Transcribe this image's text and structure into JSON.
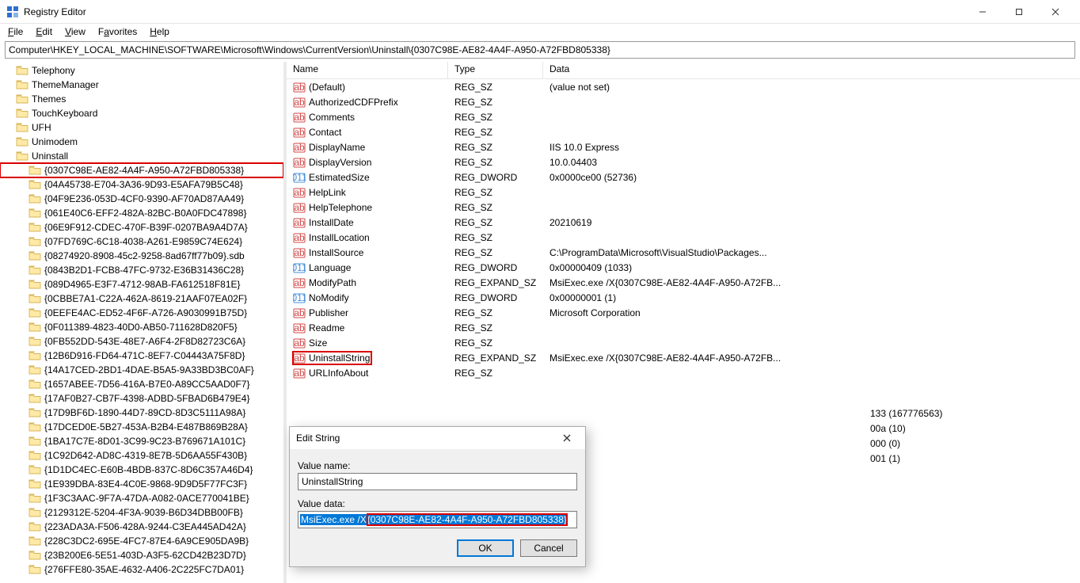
{
  "window": {
    "title": "Registry Editor"
  },
  "menu": {
    "file": "File",
    "edit": "Edit",
    "view": "View",
    "favorites": "Favorites",
    "help": "Help"
  },
  "address": "Computer\\HKEY_LOCAL_MACHINE\\SOFTWARE\\Microsoft\\Windows\\CurrentVersion\\Uninstall\\{0307C98E-AE82-4A4F-A950-A72FBD805338}",
  "tree": {
    "itemsTop": [
      "Telephony",
      "ThemeManager",
      "Themes",
      "TouchKeyboard",
      "UFH",
      "Unimodem",
      "Uninstall"
    ],
    "selected": "{0307C98E-AE82-4A4F-A950-A72FBD805338}",
    "childItems": [
      "{04A45738-E704-3A36-9D93-E5AFA79B5C48}",
      "{04F9E236-053D-4CF0-9390-AF70AD87AA49}",
      "{061E40C6-EFF2-482A-82BC-B0A0FDC47898}",
      "{06E9F912-CDEC-470F-B39F-0207BA9A4D7A}",
      "{07FD769C-6C18-4038-A261-E9859C74E624}",
      "{08274920-8908-45c2-9258-8ad67ff77b09}.sdb",
      "{0843B2D1-FCB8-47FC-9732-E36B31436C28}",
      "{089D4965-E3F7-4712-98AB-FA612518F81E}",
      "{0CBBE7A1-C22A-462A-8619-21AAF07EA02F}",
      "{0EEFE4AC-ED52-4F6F-A726-A9030991B75D}",
      "{0F011389-4823-40D0-AB50-711628D820F5}",
      "{0FB552DD-543E-48E7-A6F4-2F8D82723C6A}",
      "{12B6D916-FD64-471C-8EF7-C04443A75F8D}",
      "{14A17CED-2BD1-4DAE-B5A5-9A33BD3BC0AF}",
      "{1657ABEE-7D56-416A-B7E0-A89CC5AAD0F7}",
      "{17AF0B27-CB7F-4398-ADBD-5FBAD6B479E4}",
      "{17D9BF6D-1890-44D7-89CD-8D3C5111A98A}",
      "{17DCED0E-5B27-453A-B2B4-E487B869B28A}",
      "{1BA17C7E-8D01-3C99-9C23-B769671A101C}",
      "{1C92D642-AD8C-4319-8E7B-5D6AA55F430B}",
      "{1D1DC4EC-E60B-4BDB-837C-8D6C357A46D4}",
      "{1E939DBA-83E4-4C0E-9868-9D9D5F77FC3F}",
      "{1F3C3AAC-9F7A-47DA-A082-0ACE770041BE}",
      "{2129312E-5204-4F3A-9039-B6D34DBB00FB}",
      "{223ADA3A-F506-428A-9244-C3EA445AD42A}",
      "{228C3DC2-695E-4FC7-87E4-6A9CE905DA9B}",
      "{23B200E6-5E51-403D-A3F5-62CD42B23D7D}",
      "{276FFE80-35AE-4632-A406-2C225FC7DA01}"
    ]
  },
  "columns": {
    "name": "Name",
    "type": "Type",
    "data": "Data"
  },
  "values": [
    {
      "name": "(Default)",
      "icon": "sz",
      "type": "REG_SZ",
      "data": "(value not set)"
    },
    {
      "name": "AuthorizedCDFPrefix",
      "icon": "sz",
      "type": "REG_SZ",
      "data": ""
    },
    {
      "name": "Comments",
      "icon": "sz",
      "type": "REG_SZ",
      "data": ""
    },
    {
      "name": "Contact",
      "icon": "sz",
      "type": "REG_SZ",
      "data": ""
    },
    {
      "name": "DisplayName",
      "icon": "sz",
      "type": "REG_SZ",
      "data": "IIS 10.0 Express"
    },
    {
      "name": "DisplayVersion",
      "icon": "sz",
      "type": "REG_SZ",
      "data": "10.0.04403"
    },
    {
      "name": "EstimatedSize",
      "icon": "dw",
      "type": "REG_DWORD",
      "data": "0x0000ce00 (52736)"
    },
    {
      "name": "HelpLink",
      "icon": "sz",
      "type": "REG_SZ",
      "data": ""
    },
    {
      "name": "HelpTelephone",
      "icon": "sz",
      "type": "REG_SZ",
      "data": ""
    },
    {
      "name": "InstallDate",
      "icon": "sz",
      "type": "REG_SZ",
      "data": "20210619"
    },
    {
      "name": "InstallLocation",
      "icon": "sz",
      "type": "REG_SZ",
      "data": ""
    },
    {
      "name": "InstallSource",
      "icon": "sz",
      "type": "REG_SZ",
      "data": "C:\\ProgramData\\Microsoft\\VisualStudio\\Packages..."
    },
    {
      "name": "Language",
      "icon": "dw",
      "type": "REG_DWORD",
      "data": "0x00000409 (1033)"
    },
    {
      "name": "ModifyPath",
      "icon": "sz",
      "type": "REG_EXPAND_SZ",
      "data": "MsiExec.exe /X{0307C98E-AE82-4A4F-A950-A72FB..."
    },
    {
      "name": "NoModify",
      "icon": "dw",
      "type": "REG_DWORD",
      "data": "0x00000001 (1)"
    },
    {
      "name": "Publisher",
      "icon": "sz",
      "type": "REG_SZ",
      "data": "Microsoft Corporation"
    },
    {
      "name": "Readme",
      "icon": "sz",
      "type": "REG_SZ",
      "data": ""
    },
    {
      "name": "Size",
      "icon": "sz",
      "type": "REG_SZ",
      "data": ""
    },
    {
      "name": "UninstallString",
      "icon": "sz",
      "type": "REG_EXPAND_SZ",
      "data": "MsiExec.exe /X{0307C98E-AE82-4A4F-A950-A72FB...",
      "hl": true
    },
    {
      "name": "URLInfoAbout",
      "icon": "sz",
      "type": "REG_SZ",
      "data": ""
    }
  ],
  "valuesTail": [
    {
      "tail": "133 (167776563)"
    },
    {
      "tail": "00a (10)"
    },
    {
      "tail": "000 (0)"
    },
    {
      "tail": "001 (1)"
    }
  ],
  "dialog": {
    "title": "Edit String",
    "labelName": "Value name:",
    "valueName": "UninstallString",
    "labelData": "Value data:",
    "valueDataPrefix": "MsiExec.exe /X",
    "valueDataGuid": "{0307C98E-AE82-4A4F-A950-A72FBD805338}",
    "ok": "OK",
    "cancel": "Cancel"
  }
}
